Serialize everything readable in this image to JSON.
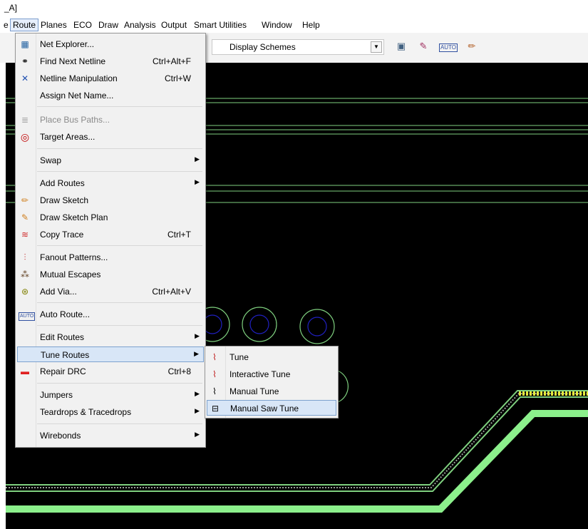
{
  "title_fragment": "_A]",
  "menubar": {
    "items": [
      {
        "label": "e"
      },
      {
        "label": "Route"
      },
      {
        "label": "Planes"
      },
      {
        "label": "ECO"
      },
      {
        "label": "Draw"
      },
      {
        "label": "Analysis"
      },
      {
        "label": "Output"
      },
      {
        "label": "Smart Utilities"
      },
      {
        "label": "Window"
      },
      {
        "label": "Help"
      }
    ]
  },
  "toolbar": {
    "display_schemes_label": "Display Schemes",
    "auto_icon_text": "AUTO"
  },
  "route_menu": {
    "items": [
      {
        "label": "Net Explorer...",
        "shortcut": "",
        "icon": "net-explorer-icon"
      },
      {
        "label": "Find Next Netline",
        "shortcut": "Ctrl+Alt+F",
        "icon": "binoculars-icon"
      },
      {
        "label": "Netline Manipulation",
        "shortcut": "Ctrl+W",
        "icon": "netline-icon"
      },
      {
        "label": "Assign Net Name...",
        "shortcut": "",
        "icon": ""
      },
      {
        "label": "Place Bus Paths...",
        "shortcut": "",
        "icon": "bus-paths-icon",
        "disabled": true
      },
      {
        "label": "Target Areas...",
        "shortcut": "",
        "icon": "target-icon"
      },
      {
        "label": "Swap",
        "shortcut": "",
        "icon": "",
        "submenu": true
      },
      {
        "label": "Add Routes",
        "shortcut": "",
        "icon": "",
        "submenu": true
      },
      {
        "label": "Draw Sketch",
        "shortcut": "",
        "icon": "pencil-icon"
      },
      {
        "label": "Draw Sketch Plan",
        "shortcut": "",
        "icon": "sketch-plan-icon"
      },
      {
        "label": "Copy Trace",
        "shortcut": "Ctrl+T",
        "icon": "copy-trace-icon"
      },
      {
        "label": "Fanout Patterns...",
        "shortcut": "",
        "icon": "fanout-icon"
      },
      {
        "label": "Mutual Escapes",
        "shortcut": "",
        "icon": "mutual-escapes-icon"
      },
      {
        "label": "Add Via...",
        "shortcut": "Ctrl+Alt+V",
        "icon": "via-icon"
      },
      {
        "label": "Auto Route...",
        "shortcut": "",
        "icon": "auto-route-icon"
      },
      {
        "label": "Edit Routes",
        "shortcut": "",
        "icon": "",
        "submenu": true
      },
      {
        "label": "Tune Routes",
        "shortcut": "",
        "icon": "",
        "submenu": true,
        "highlighted": true
      },
      {
        "label": "Repair DRC",
        "shortcut": "Ctrl+8",
        "icon": "repair-drc-icon"
      },
      {
        "label": "Jumpers",
        "shortcut": "",
        "icon": "",
        "submenu": true
      },
      {
        "label": "Teardrops & Tracedrops",
        "shortcut": "",
        "icon": "",
        "submenu": true
      },
      {
        "label": "Wirebonds",
        "shortcut": "",
        "icon": "",
        "submenu": true
      }
    ]
  },
  "tune_submenu": {
    "items": [
      {
        "label": "Tune",
        "icon": "tune-icon"
      },
      {
        "label": "Interactive Tune",
        "icon": "interactive-tune-icon"
      },
      {
        "label": "Manual Tune",
        "icon": "manual-tune-icon"
      },
      {
        "label": "Manual Saw Tune",
        "icon": "saw-tune-icon",
        "highlighted": true
      }
    ]
  },
  "colors": {
    "canvas": "#000000",
    "trace": "#8cf08c",
    "outline": "#7fd07f",
    "highlight_trace": "#e6ea3c",
    "via_inner": "#2020a0"
  }
}
